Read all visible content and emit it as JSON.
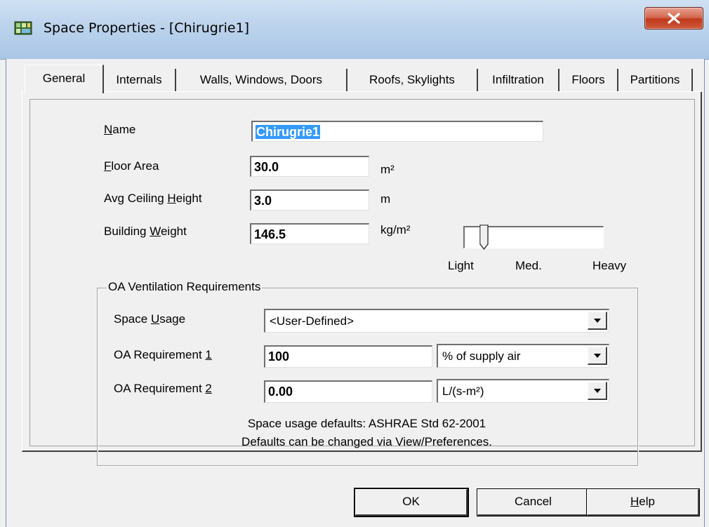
{
  "window": {
    "title": "Space Properties - [Chirugrie1]"
  },
  "tabs": [
    {
      "label": "General"
    },
    {
      "label": "Internals"
    },
    {
      "label": "Walls, Windows, Doors"
    },
    {
      "label": "Roofs, Skylights"
    },
    {
      "label": "Infiltration"
    },
    {
      "label": "Floors"
    },
    {
      "label": "Partitions"
    }
  ],
  "general": {
    "name_label_u": "N",
    "name_label_rest": "ame",
    "name_value": "Chirugrie1",
    "floor_area_label_u": "F",
    "floor_area_label_rest": "loor Area",
    "floor_area_value": "30.0",
    "floor_area_unit": "m²",
    "ceiling_label_pre": "Avg Ceiling ",
    "ceiling_label_u": "H",
    "ceiling_label_rest": "eight",
    "ceiling_value": "3.0",
    "ceiling_unit": "m",
    "weight_label_pre": "Building ",
    "weight_label_u": "W",
    "weight_label_rest": "eight",
    "weight_value": "146.5",
    "weight_unit": "kg/m²",
    "slider": {
      "level": 0.1,
      "labels": [
        "Light",
        "Med.",
        "Heavy"
      ]
    }
  },
  "ventilation": {
    "group_title": "OA Ventilation Requirements",
    "usage_label_pre": "Space ",
    "usage_label_u": "U",
    "usage_label_rest": "sage",
    "usage_value": "<User-Defined>",
    "req1_label_pre": "OA Requirement ",
    "req1_label_u": "1",
    "req1_value": "100",
    "req1_unit": "% of supply air",
    "req2_label_pre": "OA Requirement ",
    "req2_label_u": "2",
    "req2_value": "0.00",
    "req2_unit": "L/(s-m²)",
    "note_line1": "Space usage defaults: ASHRAE Std 62-2001",
    "note_line2": "Defaults can be changed via View/Preferences."
  },
  "buttons": {
    "ok": "OK",
    "cancel": "Cancel",
    "help_u": "H",
    "help_rest": "elp"
  },
  "colors": {
    "selection": "#3399ff",
    "close": "#c0391b",
    "title_bar": "#bcd3ec"
  }
}
